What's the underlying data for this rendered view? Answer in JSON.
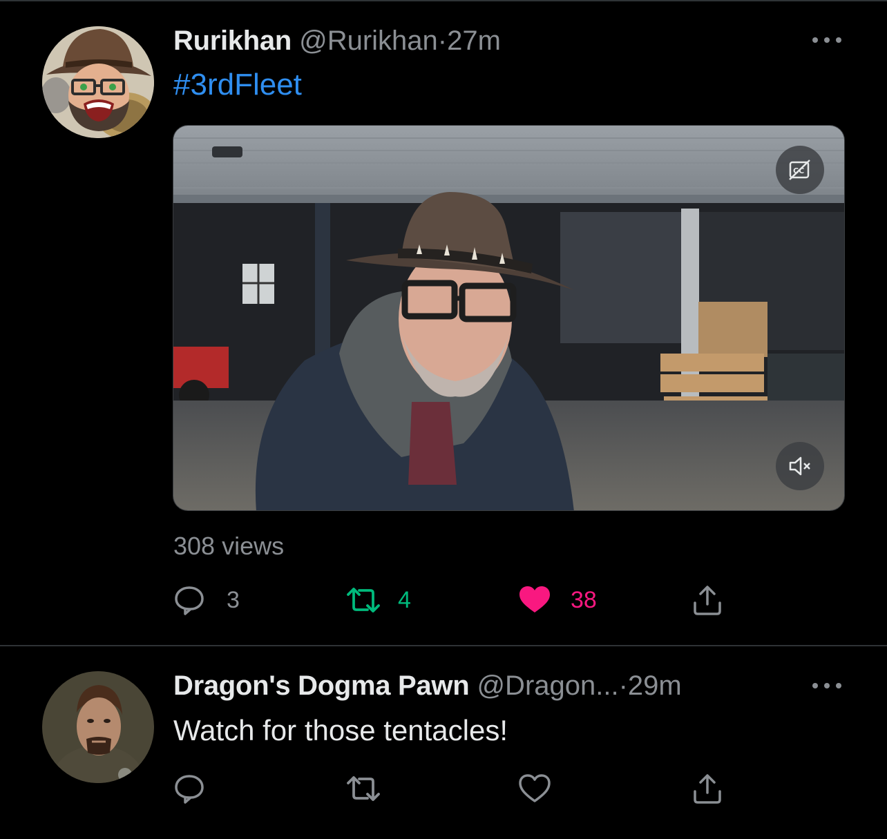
{
  "tweets": [
    {
      "name": "Rurikhan",
      "handle": "@Rurikhan",
      "separator": "·",
      "time": "27m",
      "text": "#3rdFleet",
      "views": "308 views",
      "actions": {
        "reply": "3",
        "retweet": "4",
        "like": "38"
      },
      "liked": true,
      "retweeted": true
    },
    {
      "name": "Dragon's Dogma Pawn",
      "handle": "@Dragon...",
      "separator": "·",
      "time": "29m",
      "text": "Watch for those tentacles!"
    }
  ],
  "colors": {
    "background": "#000000",
    "text": "#e7e9ea",
    "secondary": "#8b8f94",
    "link": "#2f8ef0",
    "retweet": "#00ba7c",
    "like": "#f91880"
  },
  "icons": {
    "reply": "reply-icon",
    "retweet": "retweet-icon",
    "like": "heart-icon",
    "share": "share-icon",
    "more": "more-icon",
    "captions": "captions-off-icon",
    "mute": "muted-speaker-icon"
  }
}
